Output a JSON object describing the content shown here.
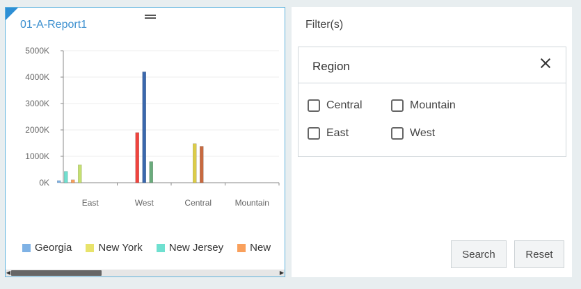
{
  "report": {
    "title": "01-A-Report1"
  },
  "chart_data": {
    "type": "bar",
    "categories": [
      "East",
      "West",
      "Central",
      "Mountain"
    ],
    "y_ticks": [
      "5000K",
      "4000K",
      "3000K",
      "2000K",
      "1000K",
      "0K"
    ],
    "ylim": [
      0,
      5000
    ],
    "grid": true,
    "legend_position": "bottom",
    "series": [
      {
        "name": "Georgia",
        "color": "#7fb2e5",
        "values": [
          80,
          0,
          0,
          0
        ]
      },
      {
        "name": "New York",
        "color": "#e8e36b",
        "values": [
          0,
          0,
          0,
          0
        ]
      },
      {
        "name": "New Jersey",
        "color": "#6fe0d0",
        "values": [
          430,
          0,
          0,
          0
        ]
      },
      {
        "name": "New",
        "color": "#f9a05c",
        "values": [
          110,
          0,
          0,
          0
        ]
      },
      {
        "name": "",
        "color": "#c5e070",
        "values": [
          680,
          0,
          0,
          0
        ]
      },
      {
        "name": "",
        "color": "#f0443e",
        "values": [
          0,
          1900,
          0,
          0
        ]
      },
      {
        "name": "",
        "color": "#3a68ad",
        "values": [
          0,
          4200,
          0,
          0
        ]
      },
      {
        "name": "",
        "color": "#6aab7c",
        "values": [
          0,
          800,
          0,
          0
        ]
      },
      {
        "name": "",
        "color": "#dccc48",
        "values": [
          0,
          0,
          1480,
          0
        ]
      },
      {
        "name": "",
        "color": "#c86a40",
        "values": [
          0,
          0,
          1380,
          0
        ]
      }
    ]
  },
  "legend": [
    {
      "label": "Georgia",
      "color": "#7fb2e5"
    },
    {
      "label": "New York",
      "color": "#e8e36b"
    },
    {
      "label": "New Jersey",
      "color": "#6fe0d0"
    },
    {
      "label": "New",
      "color": "#f9a05c"
    }
  ],
  "filter": {
    "header": "Filter(s)",
    "region_title": "Region",
    "options": [
      "Central",
      "Mountain",
      "East",
      "West"
    ],
    "search_label": "Search",
    "reset_label": "Reset"
  },
  "icons": {
    "close": "close-icon",
    "drag": "drag-handle-icon",
    "scroll_left": "scroll-left-icon",
    "scroll_right": "scroll-right-icon"
  }
}
